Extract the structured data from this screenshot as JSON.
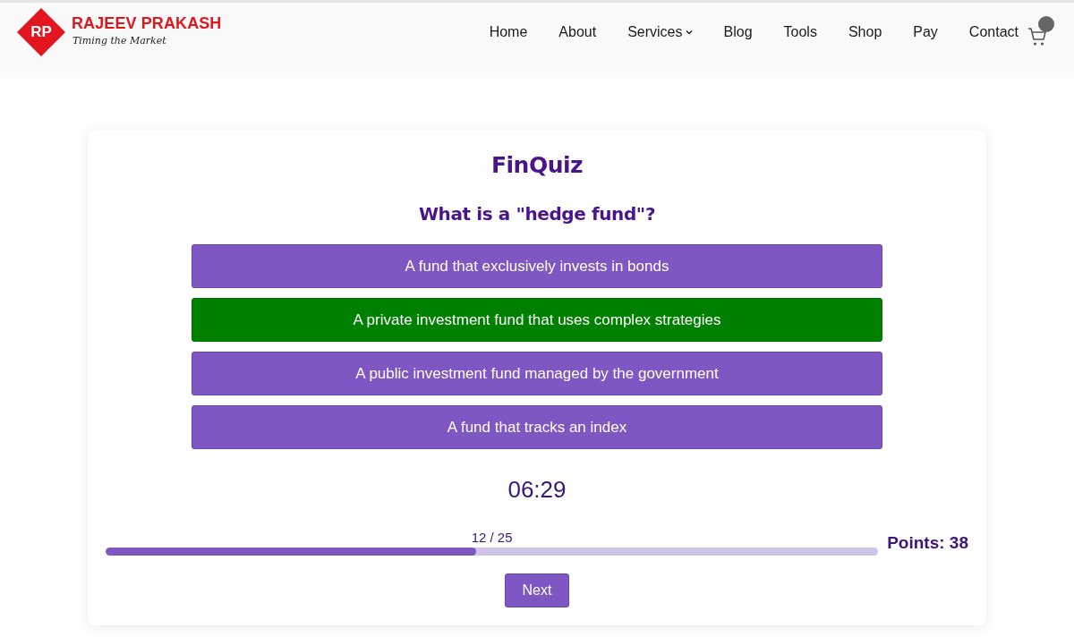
{
  "header": {
    "logo": {
      "mark": "RP",
      "name": "RAJEEV PRAKASH",
      "tagline": "Timing the Market"
    },
    "nav": [
      {
        "label": "Home",
        "has_menu": false
      },
      {
        "label": "About",
        "has_menu": false
      },
      {
        "label": "Services",
        "has_menu": true
      },
      {
        "label": "Blog",
        "has_menu": false
      },
      {
        "label": "Tools",
        "has_menu": false
      },
      {
        "label": "Shop",
        "has_menu": false
      },
      {
        "label": "Pay",
        "has_menu": false
      },
      {
        "label": "Contact",
        "has_menu": false
      }
    ]
  },
  "quiz": {
    "title": "FinQuiz",
    "question": "What is a \"hedge fund\"?",
    "options": [
      {
        "text": "A fund that exclusively invests in bonds",
        "selected": false
      },
      {
        "text": "A private investment fund that uses complex strategies",
        "selected": true
      },
      {
        "text": "A public investment fund managed by the government",
        "selected": false
      },
      {
        "text": "A fund that tracks an index",
        "selected": false
      }
    ],
    "timer": "06:29",
    "progress": {
      "label": "12 / 25",
      "level": 0.48
    },
    "points": "Points: 38",
    "next_button": "Next"
  }
}
